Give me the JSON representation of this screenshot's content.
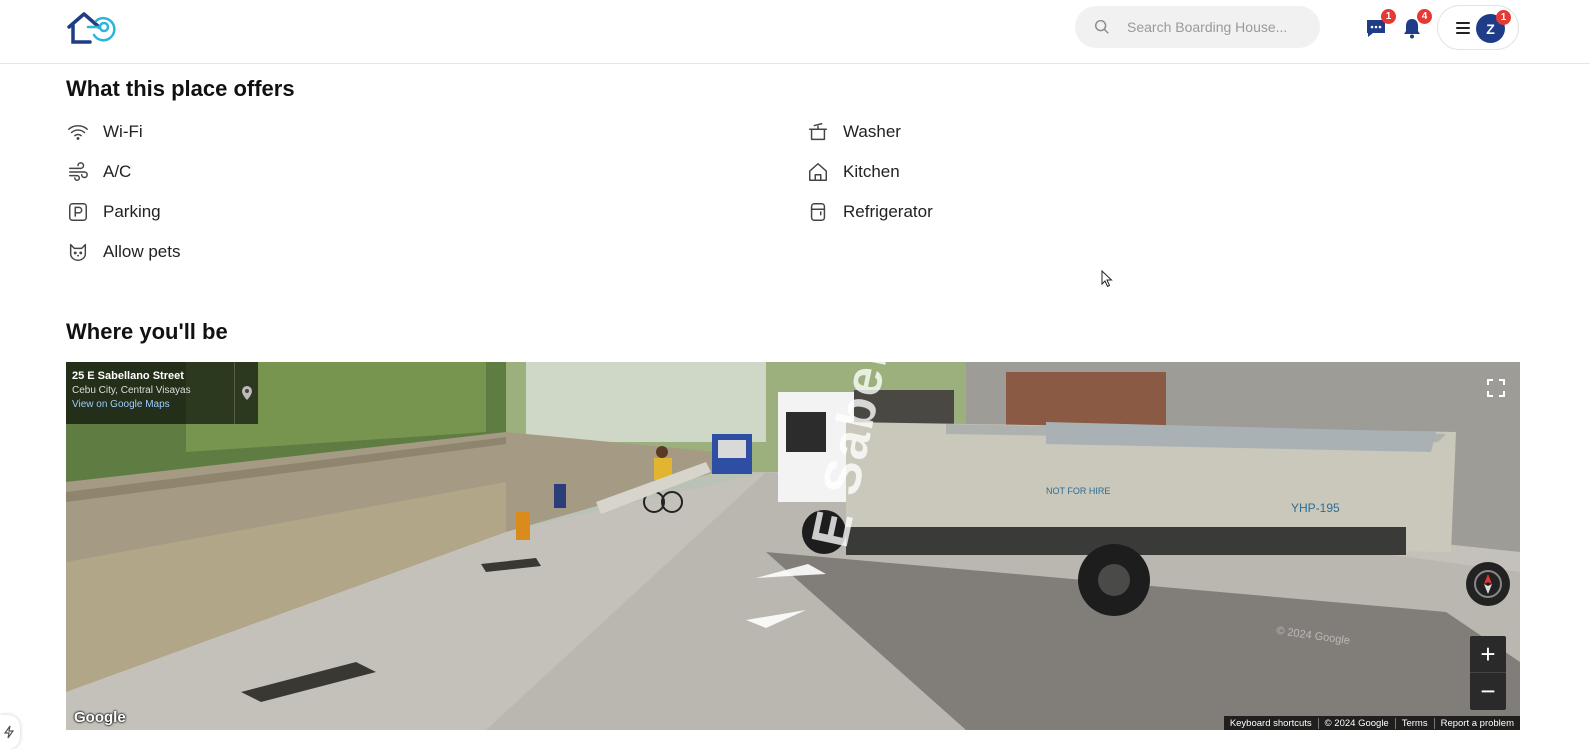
{
  "header": {
    "search_placeholder": "Search Boarding House...",
    "messages_badge": "1",
    "notifications_badge": "4",
    "avatar_initial": "Z",
    "avatar_badge": "1"
  },
  "offers": {
    "title": "What this place offers",
    "left": [
      {
        "label": "Wi-Fi",
        "icon": "wifi-icon"
      },
      {
        "label": "A/C",
        "icon": "wind-icon"
      },
      {
        "label": "Parking",
        "icon": "parking-icon"
      },
      {
        "label": "Allow pets",
        "icon": "cat-icon"
      }
    ],
    "right": [
      {
        "label": "Washer",
        "icon": "washer-icon"
      },
      {
        "label": "Kitchen",
        "icon": "home-icon"
      },
      {
        "label": "Refrigerator",
        "icon": "fridge-icon"
      }
    ]
  },
  "location": {
    "title": "Where you'll be",
    "street": "25 E Sabellano Street",
    "city": "Cebu City, Central Visayas",
    "map_link": "View on Google Maps",
    "road_label": "E Sabellano St",
    "google": "Google",
    "watermark": "© 2024 Google",
    "footer": [
      "Keyboard shortcuts",
      "© 2024 Google",
      "Terms",
      "Report a problem"
    ]
  }
}
